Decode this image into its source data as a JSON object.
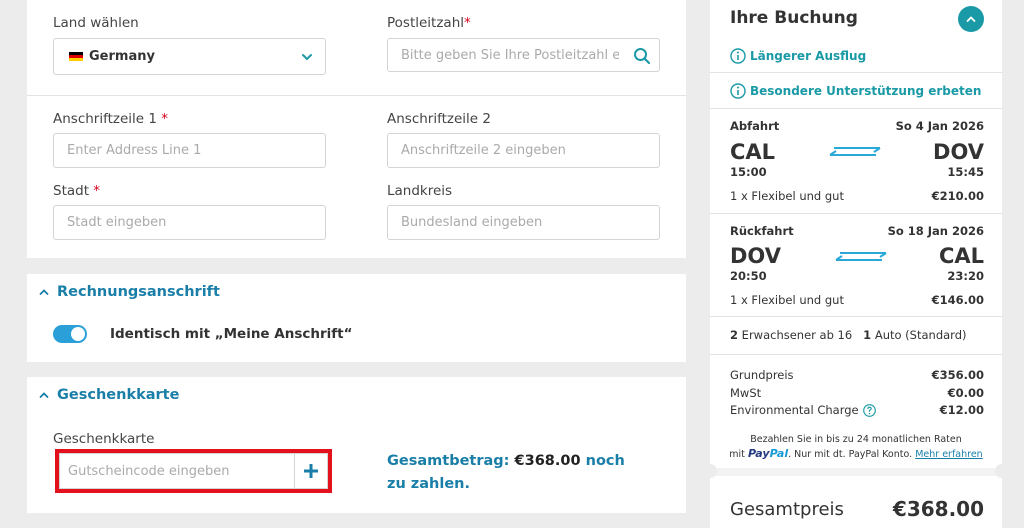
{
  "address": {
    "country_label": "Land wählen",
    "country_value": "Germany",
    "postcode_label": "Postleitzahl",
    "postcode_placeholder": "Bitte geben Sie Ihre Postleitzahl ein",
    "line1_label": "Anschriftzeile 1",
    "line1_placeholder": "Enter Address Line 1",
    "line2_label": "Anschriftzeile 2",
    "line2_placeholder": "Anschriftzeile 2 eingeben",
    "city_label": "Stadt",
    "city_placeholder": "Stadt eingeben",
    "county_label": "Landkreis",
    "county_placeholder": "Bundesland eingeben",
    "required_mark": "*"
  },
  "billing": {
    "title": "Rechnungsanschrift",
    "toggle_label": "Identisch mit „Meine Anschrift“",
    "toggle_on": true
  },
  "giftcard": {
    "title": "Geschenkkarte",
    "field_label": "Geschenkkarte",
    "placeholder": "Gutscheincode eingeben",
    "total_prefix": "Gesamtbetrag:",
    "total_amount": "€368.00",
    "total_suffix": "noch zu zahlen."
  },
  "booking": {
    "title": "Ihre Buchung",
    "links": [
      "Längerer Ausflug",
      "Besondere Unterstützung erbeten"
    ],
    "outbound": {
      "label": "Abfahrt",
      "date": "So 4 Jan 2026",
      "from": "CAL",
      "to": "DOV",
      "dep_time": "15:00",
      "arr_time": "15:45",
      "fare": "1 x Flexibel und gut",
      "price": "€210.00"
    },
    "return": {
      "label": "Rückfahrt",
      "date": "So 18 Jan 2026",
      "from": "DOV",
      "to": "CAL",
      "dep_time": "20:50",
      "arr_time": "23:20",
      "fare": "1 x Flexibel und gut",
      "price": "€146.00"
    },
    "passengers": {
      "adults_count": "2",
      "adults_label": "Erwachsener ab 16",
      "vehicle_count": "1",
      "vehicle_label": "Auto (Standard)"
    },
    "costs": [
      {
        "label": "Grundpreis",
        "value": "€356.00"
      },
      {
        "label": "MwSt",
        "value": "€0.00"
      },
      {
        "label": "Environmental Charge",
        "value": "€12.00"
      }
    ],
    "paypal": {
      "line1": "Bezahlen Sie in bis zu 24 monatlichen Raten",
      "mit": "mit",
      "brand_a": "Pay",
      "brand_b": "Pal",
      "line2": ". Nur mit dt. PayPal Konto.",
      "more": "Mehr erfahren"
    },
    "total_label": "Gesamtpreis",
    "total_value": "€368.00"
  },
  "colors": {
    "accent": "#1a7fa8",
    "teal": "#1a9aa6",
    "highlight_border": "#e3111b",
    "toggle": "#2a9fd8"
  }
}
